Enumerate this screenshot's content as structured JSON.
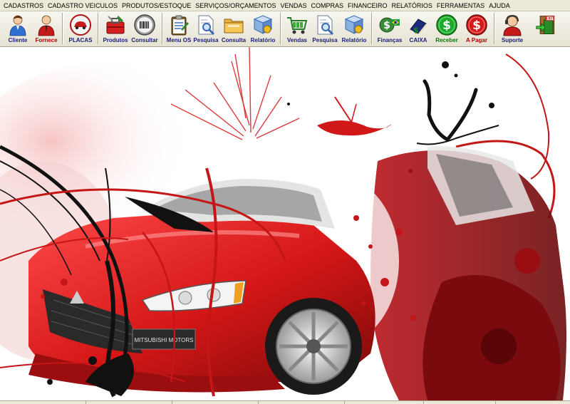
{
  "menu": [
    "CADASTROS",
    "CADASTRO VEICULOS",
    "PRODUTOS/ESTOQUE",
    "SERVIÇOS/ORÇAMENTOS",
    "VENDAS",
    "COMPRAS",
    "FINANCEIRO",
    "RELATÓRIOS",
    "FERRAMENTAS",
    "AJUDA"
  ],
  "toolbar": {
    "cliente": "Cliente",
    "fornece": "Fornece",
    "placas": "PLACAS",
    "produtos": "Produtos",
    "consultar": "Consultar",
    "menu_os": "Menu OS",
    "pesquisa_os": "Pesquisa",
    "consulta": "Consulta",
    "relatorio_os": "Relatório",
    "vendas": "Vendas",
    "pesquisa_vendas": "Pesquisa",
    "relatorio_vendas": "Relatório",
    "financas": "Finanças",
    "caixa": "CAIXA",
    "receber": "Receber",
    "a_pagar": "A Pagar",
    "suporte": "Suporte",
    "exit_badge": "EXIT"
  },
  "background": {
    "grille_text": "MITSUBISHI MOTORS"
  },
  "colors": {
    "accent_red": "#cc1a1a",
    "dark_red": "#8a0d10",
    "label_blue": "#1c1c7a",
    "label_green": "#0a7a0a",
    "chrome": "#ece9d8"
  }
}
